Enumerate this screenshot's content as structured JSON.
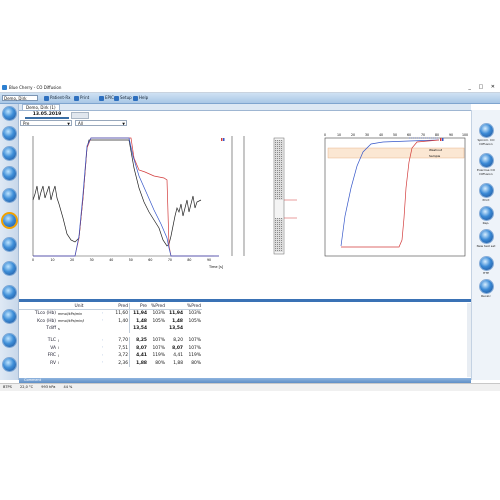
{
  "window": {
    "title": "Blue Cherry - CO Diffusion",
    "controls": "_ □ ✕"
  },
  "toolbar": {
    "patient_select": "Demo, Dirk",
    "buttons": [
      {
        "label": "Patient-Rx",
        "icon": "patient-icon"
      },
      {
        "label": "Print",
        "icon": "print-icon"
      },
      {
        "label": "EPIC",
        "icon": "epic-icon"
      },
      {
        "label": "Setup",
        "icon": "setup-icon"
      },
      {
        "label": "Help",
        "icon": "help-icon"
      }
    ]
  },
  "doc_tab": {
    "label": "Demo, Dirk (1)"
  },
  "session": {
    "date": "13.05.2019"
  },
  "filters": {
    "type_value": "Pre",
    "scope_value": "All"
  },
  "charts": {
    "left_xlabel": "Time [s]",
    "left_xticks": [
      "0",
      "10",
      "20",
      "30",
      "40",
      "50",
      "60",
      "70",
      "80",
      "90"
    ],
    "right_xticks": [
      "0",
      "10",
      "20",
      "30",
      "40",
      "50",
      "60",
      "70",
      "80",
      "90",
      "100"
    ],
    "washout_label": "Washout",
    "sample_label": "Sample"
  },
  "right_panel": [
    {
      "label": "Spirom. CO Diffusion",
      "icon": "spirometry-icon"
    },
    {
      "label": "Exercise CO Diffusion",
      "icon": "exercise-icon"
    },
    {
      "label": "Print",
      "icon": "print-icon"
    },
    {
      "label": "Rep.",
      "icon": "report-icon"
    },
    {
      "label": "New test set",
      "icon": "new-test-icon"
    },
    {
      "label": "HTE",
      "icon": "hte-icon"
    },
    {
      "label": "Recalc",
      "icon": "recalc-icon"
    }
  ],
  "table": {
    "headers": {
      "unit": "Unit",
      "pred": "Pred",
      "pre": "Pre",
      "pct_pred": "%Pred",
      "pct_pred2": "%Pred"
    },
    "rows": [
      {
        "name": "TLco (Hb)",
        "unit": "mmol/kPa/min",
        "pred": "11,60",
        "pre": "11,94",
        "pct": "103%",
        "pre2": "11,94",
        "pct2": "103%"
      },
      {
        "name": "Kco (Hb)",
        "unit": "mmol/kPa/min/l",
        "pred": "1,40",
        "pre": "1,48",
        "pct": "105%",
        "pre2": "1,48",
        "pct2": "105%"
      },
      {
        "name": "Tdiff",
        "unit": "s",
        "pred": "",
        "pre": "13,54",
        "pct": "",
        "pre2": "13,54",
        "pct2": ""
      },
      {
        "name": "TLC",
        "unit": "l",
        "pred": "7,70",
        "pre": "8,25",
        "pct": "107%",
        "pre2": "8,20",
        "pct2": "107%"
      },
      {
        "name": "VA",
        "unit": "l",
        "pred": "7,51",
        "pre": "8,07",
        "pct": "107%",
        "pre2": "8,07",
        "pct2": "107%"
      },
      {
        "name": "FRC",
        "unit": "l",
        "pred": "3,72",
        "pre": "4,41",
        "pct": "119%",
        "pre2": "4,41",
        "pct2": "119%"
      },
      {
        "name": "RV",
        "unit": "l",
        "pred": "2,36",
        "pre": "1,88",
        "pct": "80%",
        "pre2": "1,88",
        "pct2": "80%"
      }
    ]
  },
  "bottom_bar": {
    "label": "Comment"
  },
  "status": {
    "items": [
      "BTPS",
      "22,0 °C",
      "993 hPa",
      "44 %"
    ]
  }
}
